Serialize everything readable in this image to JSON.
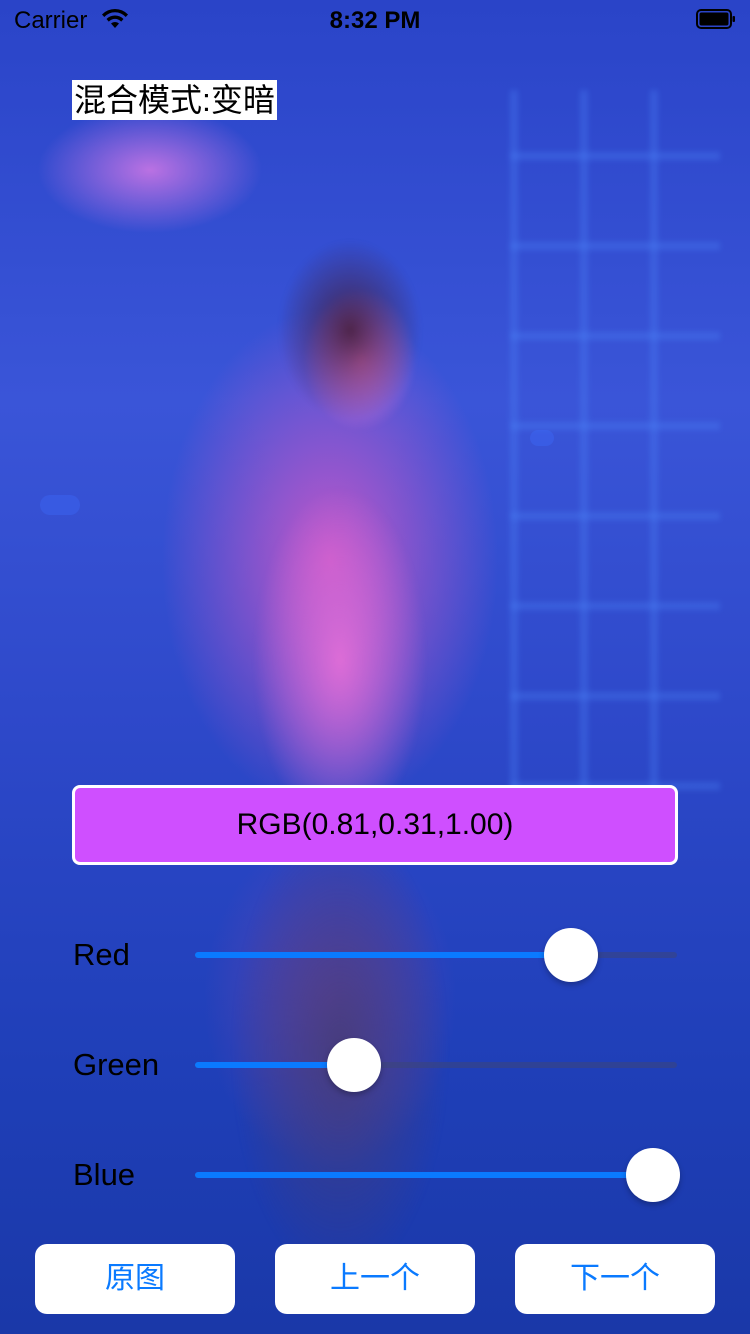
{
  "status_bar": {
    "carrier": "Carrier",
    "time": "8:32 PM",
    "wifi_icon": "wifi-icon",
    "battery_icon": "battery-icon"
  },
  "mode_label": "混合模式:变暗",
  "rgb_display": {
    "text": "RGB(0.81,0.31,1.00)",
    "color": "#cf4fff"
  },
  "sliders": [
    {
      "label": "Red",
      "value": 0.78
    },
    {
      "label": "Green",
      "value": 0.33
    },
    {
      "label": "Blue",
      "value": 0.95
    }
  ],
  "buttons": {
    "original": "原图",
    "previous": "上一个",
    "next": "下一个"
  },
  "colors": {
    "accent": "#0a7aff",
    "track": "#3c4678"
  }
}
